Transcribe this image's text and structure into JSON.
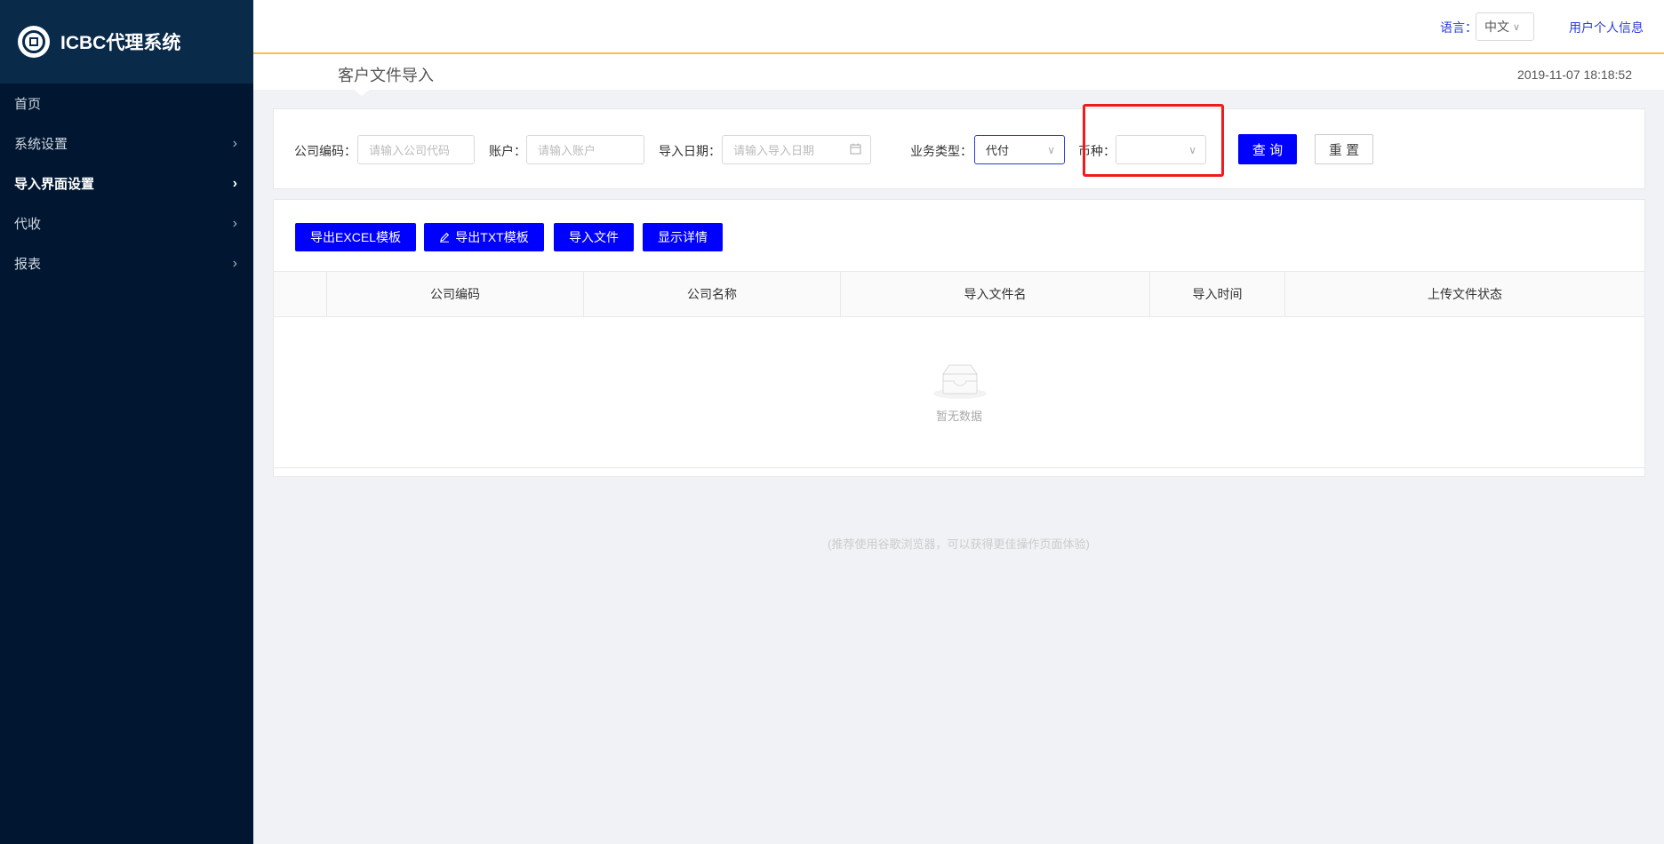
{
  "app": {
    "title": "ICBC代理系统"
  },
  "sidebar": {
    "items": [
      {
        "label": "首页",
        "chevron": ""
      },
      {
        "label": "系统设置",
        "chevron": "›"
      },
      {
        "label": "导入界面设置",
        "chevron": "›"
      },
      {
        "label": "代收",
        "chevron": "›"
      },
      {
        "label": "报表",
        "chevron": "›"
      }
    ]
  },
  "header": {
    "language_label": "语言：",
    "language_value": "中文",
    "user_info": "用户个人信息",
    "page_title": "客户文件导入",
    "timestamp": "2019-11-07 18:18:52"
  },
  "filters": {
    "company_code_label": "公司编码：",
    "company_code_placeholder": "请输入公司代码",
    "account_label": "账户：",
    "account_placeholder": "请输入账户",
    "import_date_label": "导入日期：",
    "import_date_placeholder": "请输入导入日期",
    "business_type_label": "业务类型：",
    "business_type_value": "代付",
    "currency_label": "币种：",
    "currency_value": "",
    "query_button": "查 询",
    "reset_button": "重 置"
  },
  "toolbar": {
    "export_excel": "导出EXCEL模板",
    "export_txt": "导出TXT模板",
    "import_file": "导入文件",
    "show_details": "显示详情"
  },
  "table": {
    "columns": [
      "",
      "公司编码",
      "公司名称",
      "导入文件名",
      "导入时间",
      "上传文件状态"
    ],
    "empty_text": "暂无数据"
  },
  "footer": {
    "note": "(推荐使用谷歌浏览器，可以获得更佳操作页面体验)"
  },
  "colors": {
    "sidebar_bg": "#011731",
    "primary_button": "#0000ff",
    "header_accent": "#f5c242",
    "highlight_box": "#f01c1c"
  }
}
